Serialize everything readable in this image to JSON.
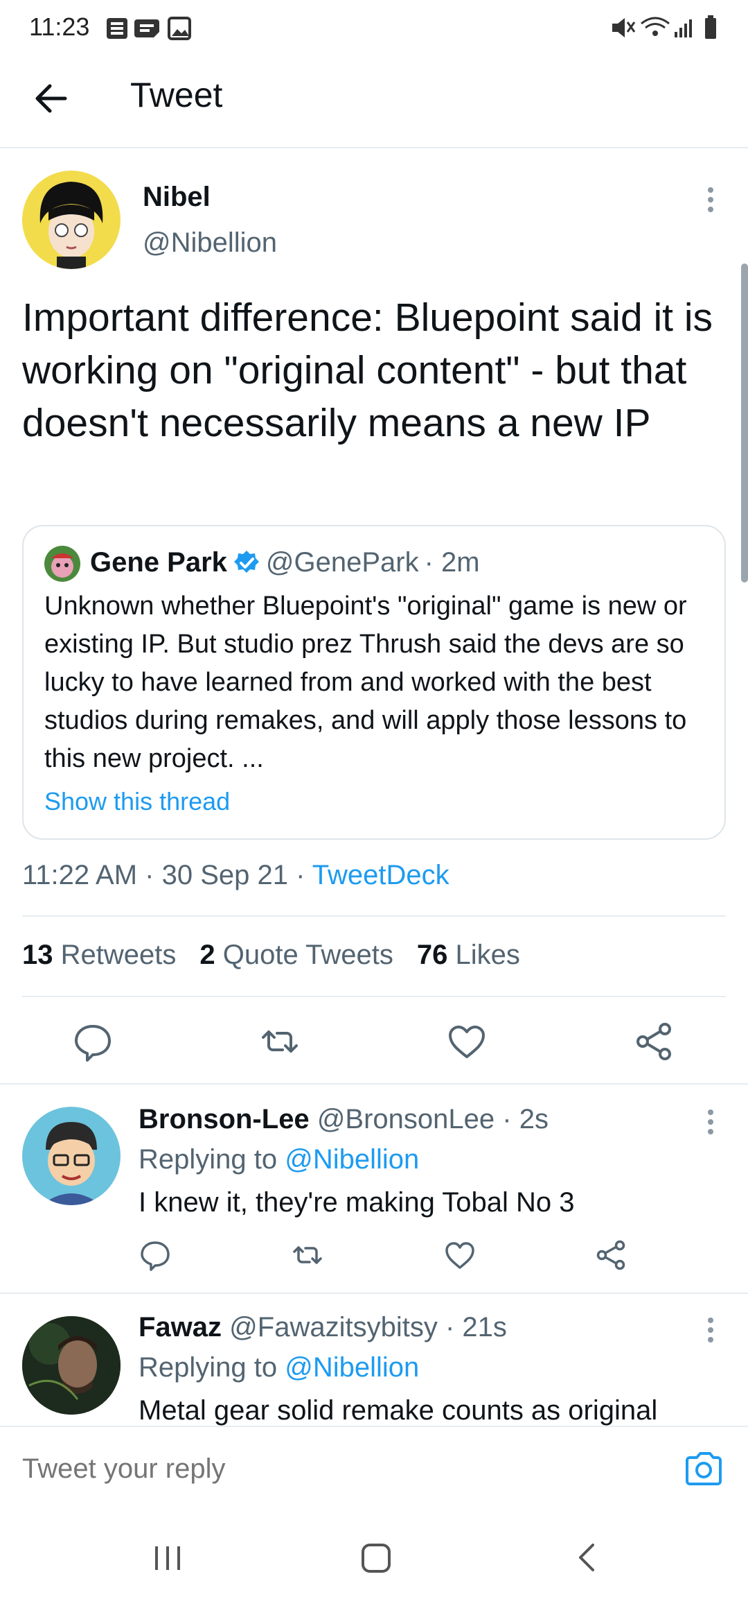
{
  "status": {
    "time": "11:23"
  },
  "header": {
    "title": "Tweet"
  },
  "tweet": {
    "name": "Nibel",
    "handle": "@Nibellion",
    "text": "Important difference: Bluepoint said it is working on \"original content\" - but that doesn't necessarily means a new IP",
    "quote": {
      "name": "Gene Park",
      "handle": "@GenePark",
      "time": "· 2m",
      "text": "Unknown whether Bluepoint's \"original\" game is new or existing IP. But studio prez Thrush said the devs are so lucky to have learned from and worked with the best studios during remakes, and will apply those lessons to this new project. ...",
      "show_thread": "Show this thread"
    },
    "meta_time": "11:22 AM · 30 Sep 21 · ",
    "meta_source": "TweetDeck",
    "stats": [
      {
        "count": "13",
        "label": "Retweets"
      },
      {
        "count": "2",
        "label": "Quote Tweets"
      },
      {
        "count": "76",
        "label": "Likes"
      }
    ]
  },
  "replies": [
    {
      "name": "Bronson-Lee",
      "handle": "@BronsonLee",
      "time": "· 2s",
      "replying_prefix": "Replying to ",
      "replying_to": "@Nibellion",
      "text": "I knew it, they're making Tobal No 3"
    },
    {
      "name": "Fawaz",
      "handle": "@Fawazitsybitsy",
      "time": "· 21s",
      "replying_prefix": "Replying to ",
      "replying_to": "@Nibellion",
      "text": "Metal gear solid remake counts as original"
    }
  ],
  "reply_input": {
    "placeholder": "Tweet your reply"
  },
  "icons": {
    "back": "back-arrow-icon",
    "more": "more-vertical-icon",
    "verified": "verified-badge-icon",
    "reply": "reply-icon",
    "retweet": "retweet-icon",
    "like": "heart-icon",
    "share": "share-icon",
    "camera": "camera-icon"
  },
  "colors": {
    "accent": "#1d9bf0",
    "text": "#0f1419",
    "muted": "#536471"
  }
}
